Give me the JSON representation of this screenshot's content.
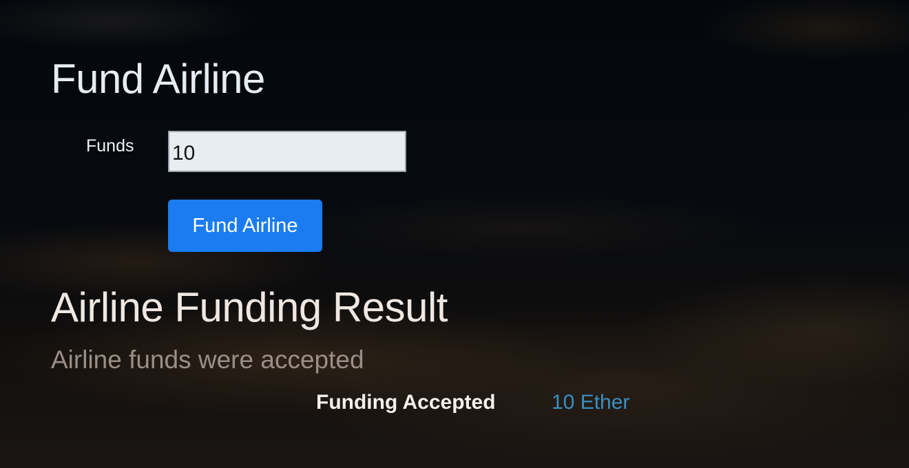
{
  "fund_section": {
    "title": "Fund Airline",
    "funds_label": "Funds",
    "funds_value": "10",
    "button_label": "Fund Airline"
  },
  "result_section": {
    "title": "Airline Funding Result",
    "subtitle": "Airline funds were accepted",
    "rows": [
      {
        "label": "Funding Accepted",
        "value": "10 Ether"
      }
    ]
  },
  "colors": {
    "button": "#1a7cf0",
    "result_value": "#3a8fc2",
    "background": "#05080d"
  }
}
